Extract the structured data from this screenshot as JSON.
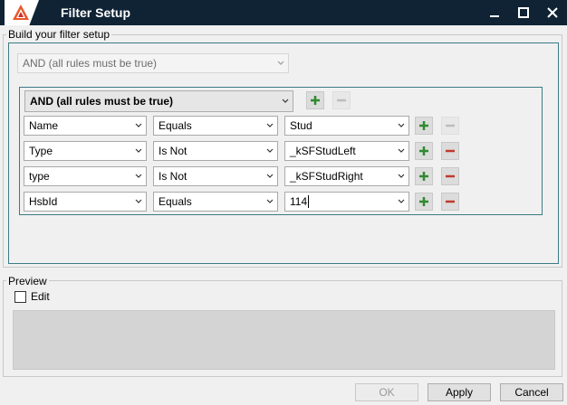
{
  "window": {
    "title": "Filter Setup"
  },
  "build_section": {
    "legend": "Build your filter setup",
    "outer_operator": "AND (all rules must be true)",
    "group_operator": "AND (all rules must be true)",
    "rules": [
      {
        "field": "Name",
        "operator": "Equals",
        "value": "Stud",
        "remove_enabled": false
      },
      {
        "field": "Type",
        "operator": "Is Not",
        "value": "_kSFStudLeft",
        "remove_enabled": true
      },
      {
        "field": "type",
        "operator": "Is Not",
        "value": "_kSFStudRight",
        "remove_enabled": true
      },
      {
        "field": "HsbId",
        "operator": "Equals",
        "value": "114",
        "remove_enabled": true
      }
    ]
  },
  "preview_section": {
    "legend": "Preview",
    "edit_label": "Edit",
    "edit_checked": false
  },
  "footer": {
    "ok_label": "OK",
    "apply_label": "Apply",
    "cancel_label": "Cancel"
  },
  "colors": {
    "titlebar": "#0f2335",
    "accent_border": "#3b7b86",
    "add_icon": "#2e8b2e",
    "remove_icon": "#c0392b"
  },
  "icons": {
    "add": "plus-icon",
    "remove": "minus-icon",
    "dropdown": "chevron-down-icon"
  }
}
